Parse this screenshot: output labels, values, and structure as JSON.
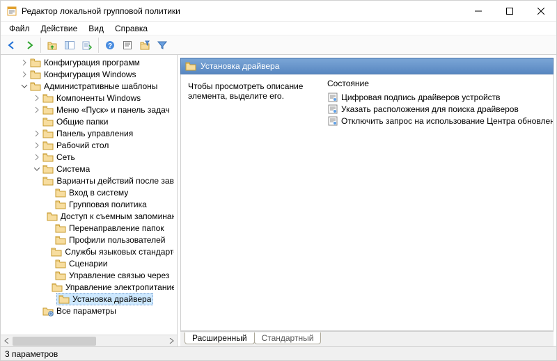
{
  "window": {
    "title": "Редактор локальной групповой политики"
  },
  "menu": {
    "file": "Файл",
    "action": "Действие",
    "view": "Вид",
    "help": "Справка"
  },
  "header": {
    "label": "Установка драйвера"
  },
  "description": {
    "hint": "Чтобы просмотреть описание элемента, выделите его."
  },
  "column": {
    "state": "Состояние"
  },
  "settings": [
    {
      "label": "Цифровая подпись драйверов устройств"
    },
    {
      "label": "Указать расположения для поиска драйверов"
    },
    {
      "label": "Отключить запрос на использование Центра обновления"
    }
  ],
  "tabs": {
    "extended": "Расширенный",
    "standard": "Стандартный"
  },
  "status": {
    "count": "3 параметров"
  },
  "tree": [
    {
      "depth": 1,
      "twisty": "closed",
      "label": "Конфигурация программ"
    },
    {
      "depth": 1,
      "twisty": "closed",
      "label": "Конфигурация Windows"
    },
    {
      "depth": 1,
      "twisty": "open",
      "label": "Административные шаблоны"
    },
    {
      "depth": 2,
      "twisty": "closed",
      "label": "Компоненты Windows"
    },
    {
      "depth": 2,
      "twisty": "closed",
      "label": "Меню «Пуск» и панель задач"
    },
    {
      "depth": 2,
      "twisty": "none",
      "label": "Общие папки"
    },
    {
      "depth": 2,
      "twisty": "closed",
      "label": "Панель управления"
    },
    {
      "depth": 2,
      "twisty": "closed",
      "label": "Рабочий стол"
    },
    {
      "depth": 2,
      "twisty": "closed",
      "label": "Сеть"
    },
    {
      "depth": 2,
      "twisty": "open",
      "label": "Система"
    },
    {
      "depth": 3,
      "twisty": "none",
      "label": "Варианты действий после завершения"
    },
    {
      "depth": 3,
      "twisty": "none",
      "label": "Вход в систему"
    },
    {
      "depth": 3,
      "twisty": "none",
      "label": "Групповая политика"
    },
    {
      "depth": 3,
      "twisty": "none",
      "label": "Доступ к съемным запоминающим"
    },
    {
      "depth": 3,
      "twisty": "none",
      "label": "Перенаправление папок"
    },
    {
      "depth": 3,
      "twisty": "none",
      "label": "Профили пользователей"
    },
    {
      "depth": 3,
      "twisty": "none",
      "label": "Службы языковых стандартов"
    },
    {
      "depth": 3,
      "twisty": "none",
      "label": "Сценарии"
    },
    {
      "depth": 3,
      "twisty": "none",
      "label": "Управление связью через"
    },
    {
      "depth": 3,
      "twisty": "none",
      "label": "Управление электропитанием"
    },
    {
      "depth": 3,
      "twisty": "none",
      "label": "Установка драйвера",
      "selected": true
    },
    {
      "depth": 2,
      "twisty": "none",
      "label": "Все параметры",
      "variant": "all"
    }
  ]
}
